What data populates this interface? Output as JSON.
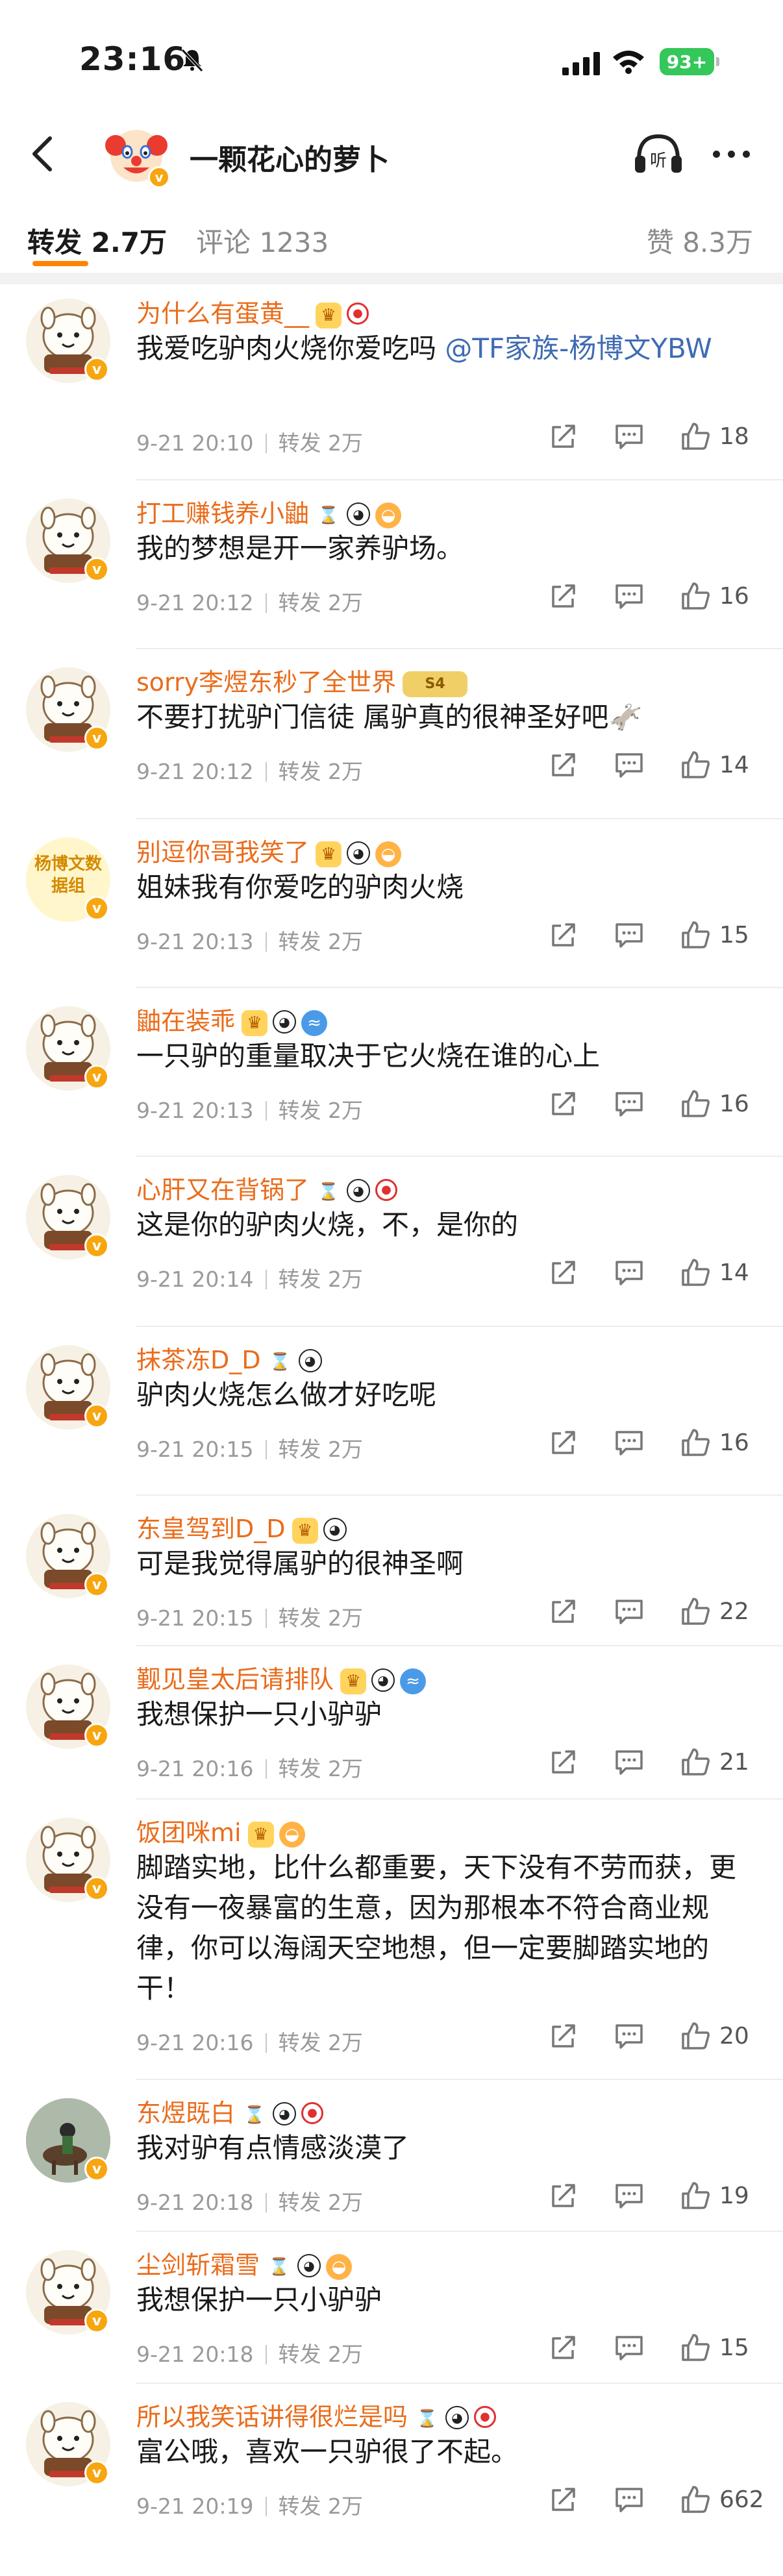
{
  "status_bar": {
    "time": "23:16",
    "battery": "93+"
  },
  "header": {
    "title": "一颗花心的萝卜",
    "listen_label": "听"
  },
  "tabs": {
    "repost": "转发 2.7万",
    "comment": "评论 1233",
    "like": "赞 8.3万"
  },
  "repost_label": "转发 2万",
  "items": [
    {
      "username": "为什么有蛋黄__",
      "badges": [
        "crown",
        "heart"
      ],
      "text": "我爱吃驴肉火烧你爱吃吗 ",
      "mention": "@TF家族-杨博文YBW",
      "time": "9-21 20:10",
      "likes": "18"
    },
    {
      "username": "打工赚钱养小鼬",
      "badges": [
        "sand",
        "panda",
        "fish"
      ],
      "text": "我的梦想是开一家养驴场。",
      "time": "9-21 20:12",
      "likes": "16"
    },
    {
      "username": "sorry李煜东秒了全世界",
      "badges": [
        "lvl"
      ],
      "level": "S4",
      "text": "不要打扰驴门信徒 属驴真的很神圣好吧🫏",
      "time": "9-21 20:12",
      "likes": "14"
    },
    {
      "username": "别逗你哥我笑了",
      "badges": [
        "crown",
        "panda",
        "fish"
      ],
      "avatar_text": "杨博文数据组",
      "text": "姐妹我有你爱吃的驴肉火烧",
      "time": "9-21 20:13",
      "likes": "15"
    },
    {
      "username": "鼬在装乖",
      "badges": [
        "crown",
        "panda",
        "wave"
      ],
      "text": "一只驴的重量取决于它火烧在谁的心上",
      "time": "9-21 20:13",
      "likes": "16"
    },
    {
      "username": "心肝又在背锅了",
      "badges": [
        "sand",
        "panda",
        "heart"
      ],
      "text": "这是你的驴肉火烧，不，是你的",
      "time": "9-21 20:14",
      "likes": "14"
    },
    {
      "username": "抹茶冻D_D",
      "badges": [
        "sand",
        "panda"
      ],
      "text": "驴肉火烧怎么做才好吃呢",
      "time": "9-21 20:15",
      "likes": "16"
    },
    {
      "username": "东皇驾到D_D",
      "badges": [
        "crown",
        "panda"
      ],
      "text": "可是我觉得属驴的很神圣啊",
      "time": "9-21 20:15",
      "likes": "22"
    },
    {
      "username": "觐见皇太后请排队",
      "badges": [
        "crown",
        "panda",
        "wave"
      ],
      "text": "我想保护一只小驴驴",
      "time": "9-21 20:16",
      "likes": "21"
    },
    {
      "username": "饭团咪mi",
      "badges": [
        "crown",
        "fish"
      ],
      "text": "脚踏实地，比什么都重要，天下没有不劳而获，更没有一夜暴富的生意，因为那根本不符合商业规律，你可以海阔天空地想，但一定要脚踏实地的干！",
      "time": "9-21 20:16",
      "likes": "20"
    },
    {
      "username": "东煜既白",
      "badges": [
        "sand",
        "panda",
        "heart"
      ],
      "text": "我对驴有点情感淡漠了",
      "time": "9-21 20:18",
      "likes": "19"
    },
    {
      "username": "尘剑斩霜雪",
      "badges": [
        "sand",
        "panda",
        "fish"
      ],
      "text": "我想保护一只小驴驴",
      "time": "9-21 20:18",
      "likes": "15"
    },
    {
      "username": "所以我笑话讲得很烂是吗",
      "badges": [
        "sand",
        "panda",
        "heart"
      ],
      "text": "富公哦，喜欢一只驴很了不起。",
      "time": "9-21 20:19",
      "likes": "662"
    }
  ],
  "colors": {
    "accent": "#ff8200",
    "username": "#ea6c1b",
    "mention": "#3f6bb3",
    "verified": "#f7a60f"
  },
  "icons": [
    "back-arrow-icon",
    "listen-headphone-icon",
    "more-dots-icon",
    "share-icon",
    "comment-icon",
    "like-thumb-icon",
    "verified-v-icon"
  ]
}
